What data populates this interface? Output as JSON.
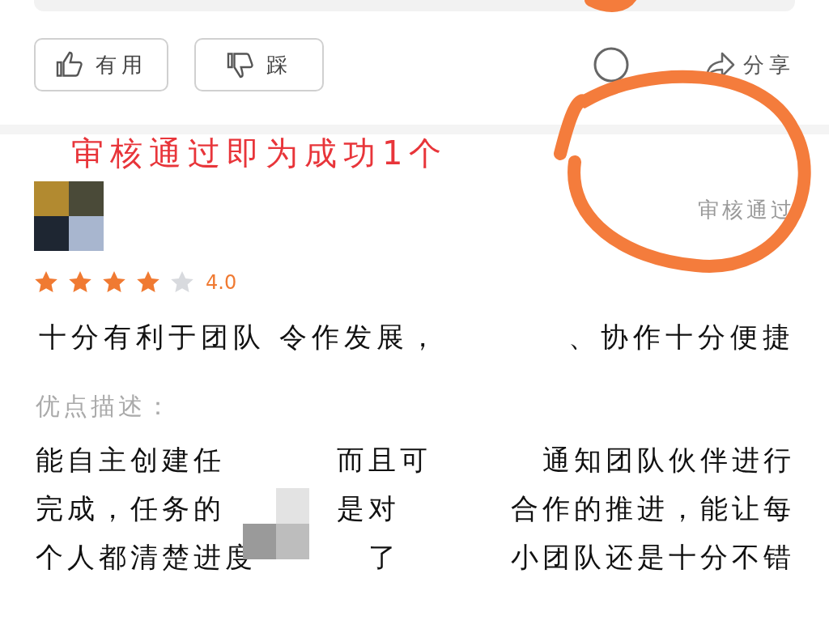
{
  "actions": {
    "buttons": [
      {
        "kind": "like",
        "label": "有用"
      },
      {
        "kind": "dislike",
        "label": "踩"
      }
    ],
    "share": {
      "label": "分享"
    }
  },
  "annotation": {
    "text": "审核通过即为成功1个"
  },
  "review": {
    "status": "审核通过",
    "stars": 4,
    "rating": "4.0",
    "summary": [
      "十分有利于团队 令作发展，",
      "、协作十分便捷"
    ],
    "pros_label": "优点描述：",
    "pros_lines": [
      [
        "能自主创建任",
        "而且可",
        "通知团队伙伴进行"
      ],
      [
        "完成，任务的",
        "是对",
        "合作的推进，能让每"
      ],
      [
        "个人都清楚进度",
        "了",
        "小团队还是十分不错"
      ]
    ]
  }
}
